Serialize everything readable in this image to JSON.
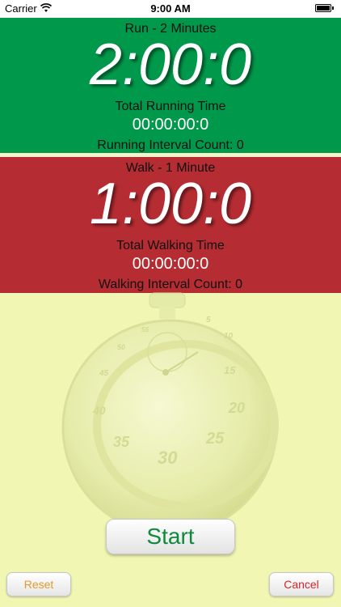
{
  "status_bar": {
    "carrier": "Carrier",
    "time": "9:00 AM"
  },
  "run": {
    "title": "Run - 2 Minutes",
    "timer": "2:00:0",
    "total_label": "Total Running Time",
    "total_value": "00:00:00:0",
    "interval_count": "Running Interval Count: 0",
    "color": "#00984a"
  },
  "walk": {
    "title": "Walk - 1 Minute",
    "timer": "1:00:0",
    "total_label": "Total Walking Time",
    "total_value": "00:00:00:0",
    "interval_count": "Walking Interval Count: 0",
    "color": "#b52c32"
  },
  "stopwatch": {
    "dial_numbers": [
      "5",
      "10",
      "15",
      "20",
      "25",
      "30",
      "35",
      "40",
      "45",
      "50",
      "55"
    ]
  },
  "buttons": {
    "start": "Start",
    "reset": "Reset",
    "cancel": "Cancel"
  },
  "colors": {
    "background": "#f1f7b3",
    "start_text": "#0f8a3c",
    "reset_text": "#e59a2a",
    "cancel_text": "#d9232a"
  }
}
